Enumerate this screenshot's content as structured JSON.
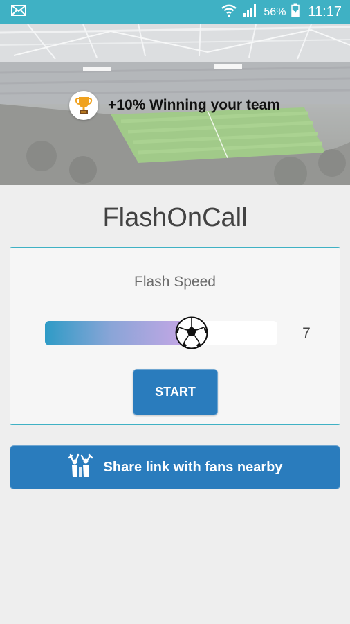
{
  "status_bar": {
    "notification_icon": "mail-icon",
    "wifi_icon": "wifi-icon",
    "signal_icon": "signal-icon",
    "battery_icon": "battery-charging-icon",
    "battery_percent": "56%",
    "time": "11:17"
  },
  "banner": {
    "icon": "trophy-icon",
    "promo_text": "+10% Winning your team"
  },
  "app_title": "FlashOnCall",
  "flash_speed": {
    "label": "Flash Speed",
    "value": "7",
    "fill_fraction": 0.63,
    "thumb_icon": "soccer-ball-icon"
  },
  "start_button": {
    "label": "START"
  },
  "share_button": {
    "icon": "fans-cheering-icon",
    "label": "Share link with fans nearby"
  },
  "colors": {
    "status_bar": "#3fb1c4",
    "primary_button": "#2a7cbd",
    "card_border": "#3fb1c4",
    "background": "#eeeeee"
  }
}
